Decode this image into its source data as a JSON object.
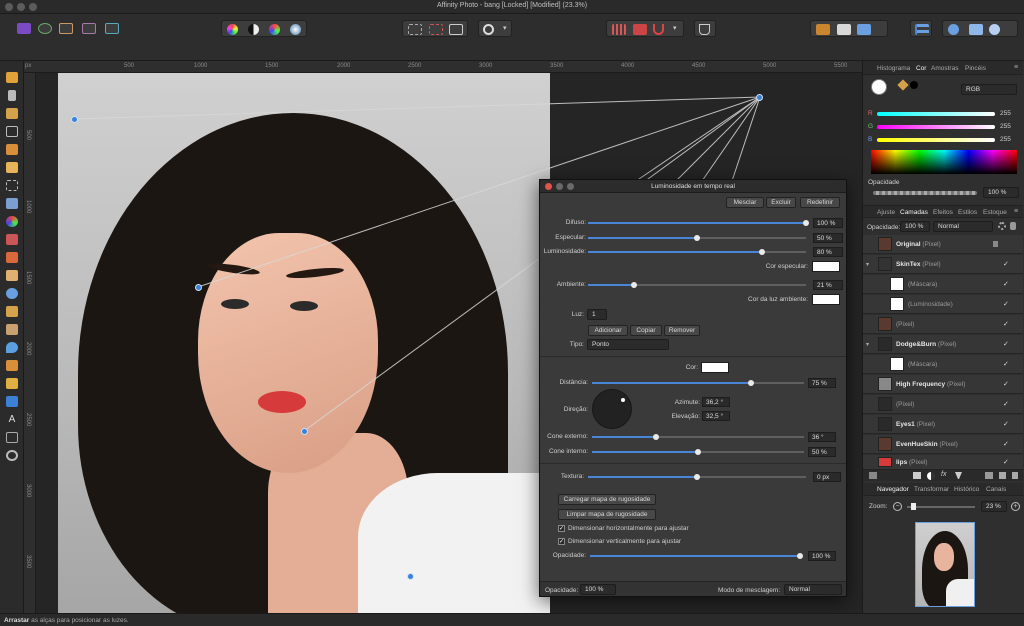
{
  "window": {
    "title": "Affinity Photo - bang [Locked] [Modified] (23.3%)"
  },
  "ruler": {
    "unit": "px",
    "top_ticks": [
      "500",
      "1000",
      "1500",
      "2000",
      "2500",
      "3000",
      "3500",
      "4000",
      "4500",
      "5000",
      "5500"
    ],
    "left_ticks": [
      "500",
      "1000",
      "1500",
      "2000",
      "2500",
      "3000",
      "3500",
      "4000"
    ]
  },
  "dialog": {
    "title": "Luminosidade em tempo real",
    "buttons": {
      "merge": "Mesclar",
      "delete": "Excluir",
      "reset": "Redefinir"
    },
    "sliders": [
      {
        "label": "Difuso:",
        "value": "100 %",
        "fraction": 1.0
      },
      {
        "label": "Especular:",
        "value": "50 %",
        "fraction": 0.5
      },
      {
        "label": "Luminosidade:",
        "value": "80 %",
        "fraction": 0.8
      }
    ],
    "specular_color_label": "Cor especular:",
    "ambient": {
      "label": "Ambiente:",
      "value": "21 %",
      "fraction": 0.21
    },
    "ambient_color_label": "Cor da luz ambiente:",
    "light": {
      "label": "Luz:",
      "value": "1"
    },
    "light_buttons": {
      "add": "Adicionar",
      "copy": "Copiar",
      "remove": "Remover"
    },
    "type": {
      "label": "Tipo:",
      "value": "Ponto"
    },
    "color_label": "Cor:",
    "distance": {
      "label": "Distância:",
      "value": "75 %",
      "fraction": 0.75
    },
    "direction_label": "Direção:",
    "azimuth": {
      "label": "Azimute:",
      "value": "36,2 °"
    },
    "elevation": {
      "label": "Elevação:",
      "value": "32,5 °"
    },
    "outer_cone": {
      "label": "Cone externo:",
      "value": "36 °",
      "fraction": 0.3
    },
    "inner_cone": {
      "label": "Cone interno:",
      "value": "50 %",
      "fraction": 0.5
    },
    "texture": {
      "label": "Textura:",
      "value": "0 px",
      "fraction": 0.5
    },
    "load_map": "Carregar mapa de rugosidade",
    "clear_map": "Limpar mapa de rugosidade",
    "scale_h": "Dimensionar horizontalmente para ajustar",
    "scale_v": "Dimensionar verticalmente para ajustar",
    "opacity": {
      "label": "Opacidade:",
      "value": "100 %",
      "fraction": 1.0
    },
    "footer": {
      "opacity_label": "Opacidade:",
      "opacity_value": "100 %",
      "blend_label": "Modo de mesclagem:",
      "blend_value": "Normal"
    }
  },
  "color_panel": {
    "tabs": [
      "Histograma",
      "Cor",
      "Amostras",
      "Pincéis"
    ],
    "mode": "RGB",
    "channels": [
      {
        "label": "R",
        "value": "255"
      },
      {
        "label": "G",
        "value": "255"
      },
      {
        "label": "B",
        "value": "255"
      }
    ],
    "opacity_label": "Opacidade",
    "opacity_value": "100 %"
  },
  "layers_panel": {
    "tabs": [
      "Ajuste",
      "Camadas",
      "Efeitos",
      "Estilos",
      "Estoque"
    ],
    "opacity_label": "Opacidade:",
    "opacity_value": "100 %",
    "blend_value": "Normal",
    "layers": [
      {
        "name": "Original",
        "kind": "(Pixel)",
        "check": "",
        "indent": 0
      },
      {
        "name": "SkinTex",
        "kind": "(Pixel)",
        "check": "✓",
        "indent": 0
      },
      {
        "name": "",
        "kind": "(Máscara)",
        "check": "✓",
        "indent": 1
      },
      {
        "name": "",
        "kind": "(Luminosidade)",
        "check": "✓",
        "indent": 1
      },
      {
        "name": "",
        "kind": "(Pixel)",
        "check": "✓",
        "indent": 0
      },
      {
        "name": "Dodge&Burn",
        "kind": "(Pixel)",
        "check": "✓",
        "indent": 0
      },
      {
        "name": "",
        "kind": "(Máscara)",
        "check": "✓",
        "indent": 1
      },
      {
        "name": "High Frequency",
        "kind": "(Pixel)",
        "check": "✓",
        "indent": 0
      },
      {
        "name": "",
        "kind": "(Pixel)",
        "check": "✓",
        "indent": 0
      },
      {
        "name": "Eyes1",
        "kind": "(Pixel)",
        "check": "✓",
        "indent": 0
      },
      {
        "name": "EvenHueSkin",
        "kind": "(Pixel)",
        "check": "✓",
        "indent": 0
      },
      {
        "name": "lips",
        "kind": "(Pixel)",
        "check": "✓",
        "indent": 0
      }
    ]
  },
  "navigator_panel": {
    "tabs": [
      "Navegador",
      "Transformar",
      "Histórico",
      "Canais"
    ],
    "zoom_label": "Zoom:",
    "zoom_value": "23 %"
  },
  "status": {
    "strong": "Arrastar",
    "text": " as alças para posicionar as luzes."
  },
  "colors": {
    "accent": "#4a86d8",
    "dialog_bg": "#3a3a3a",
    "panel_bg": "#2f2f2f",
    "lips": "#d63a3a"
  }
}
